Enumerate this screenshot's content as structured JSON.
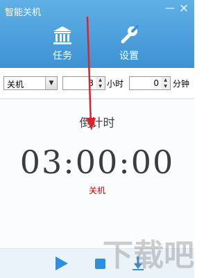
{
  "window": {
    "title": "智能关机",
    "minimize_symbol": "—",
    "close_symbol": "×"
  },
  "nav": [
    {
      "label": "任务",
      "icon": "bank-icon"
    },
    {
      "label": "设置",
      "icon": "wrench-icon"
    }
  ],
  "toolbar": {
    "action_select_value": "关机",
    "hours_value": "3",
    "hours_unit": "小时",
    "minutes_value": "0",
    "minutes_unit": "分钟"
  },
  "countdown": {
    "label": "倒计时",
    "time": "03:00:00",
    "action": "关机"
  },
  "footer": {
    "buttons": [
      "play-icon",
      "stop-icon",
      "download-icon"
    ]
  },
  "watermark": {
    "text": "下载吧"
  },
  "colors": {
    "header_top": "#5fb0e6",
    "header_bottom": "#3e92d3",
    "accent_blue": "#2d8fdd",
    "action_red": "#cc0000",
    "arrow_red": "#e0202a"
  }
}
